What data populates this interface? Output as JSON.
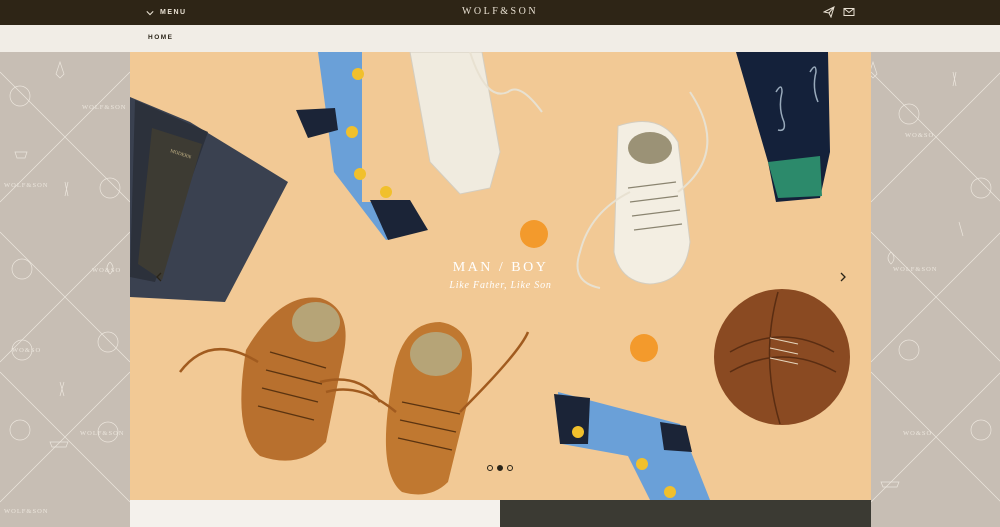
{
  "header": {
    "menu_label": "MENU",
    "brand": "WOLF&SON"
  },
  "breadcrumb": {
    "home": "HOME"
  },
  "side_pattern": {
    "words": [
      "WO&SO",
      "WOLF&SON"
    ]
  },
  "hero": {
    "title": "MAN / BOY",
    "subtitle": "Like Father, Like Son",
    "slides": 3,
    "active_slide": 2
  },
  "colors": {
    "topbar": "#2e2516",
    "crumbbar": "#f1ede6",
    "side": "#c7beb4",
    "hero_bg": "#f2c995"
  },
  "icons": [
    "chevron-down-icon",
    "paper-plane-icon",
    "envelope-icon",
    "chevron-left-icon",
    "chevron-right-icon"
  ]
}
